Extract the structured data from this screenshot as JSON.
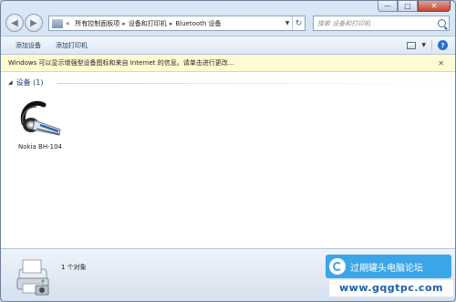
{
  "caption": {
    "minimize": "—",
    "maximize": "□",
    "close": "✕"
  },
  "nav": {
    "back": "◀",
    "forward": "▶"
  },
  "address": {
    "prefix": "«",
    "crumbs": [
      "所有控制面板项",
      "设备和打印机",
      "Bluetooth 设备"
    ],
    "separator": "▸"
  },
  "search": {
    "placeholder": "搜索 设备和打印机"
  },
  "toolbar": {
    "add_device": "添加设备",
    "add_printer": "添加打印机",
    "help": "?"
  },
  "infobar": {
    "text": "Windows 可以显示增强型设备图标和来自 Internet 的信息。请单击进行更改...",
    "close": "✕"
  },
  "group": {
    "title": "设备 (1)"
  },
  "devices": [
    {
      "name": "Nokia BH-104",
      "icon": "bluetooth-headset-icon"
    }
  ],
  "details": {
    "count": "1 个对象"
  },
  "watermark": {
    "text": "过期罐头电脑论坛",
    "url": "www.gqgtpc.com"
  },
  "colors": {
    "infobar_bg": "#fefbd2",
    "frame": "#c5d8ee",
    "watermark_bg": "#3aa6e8"
  }
}
